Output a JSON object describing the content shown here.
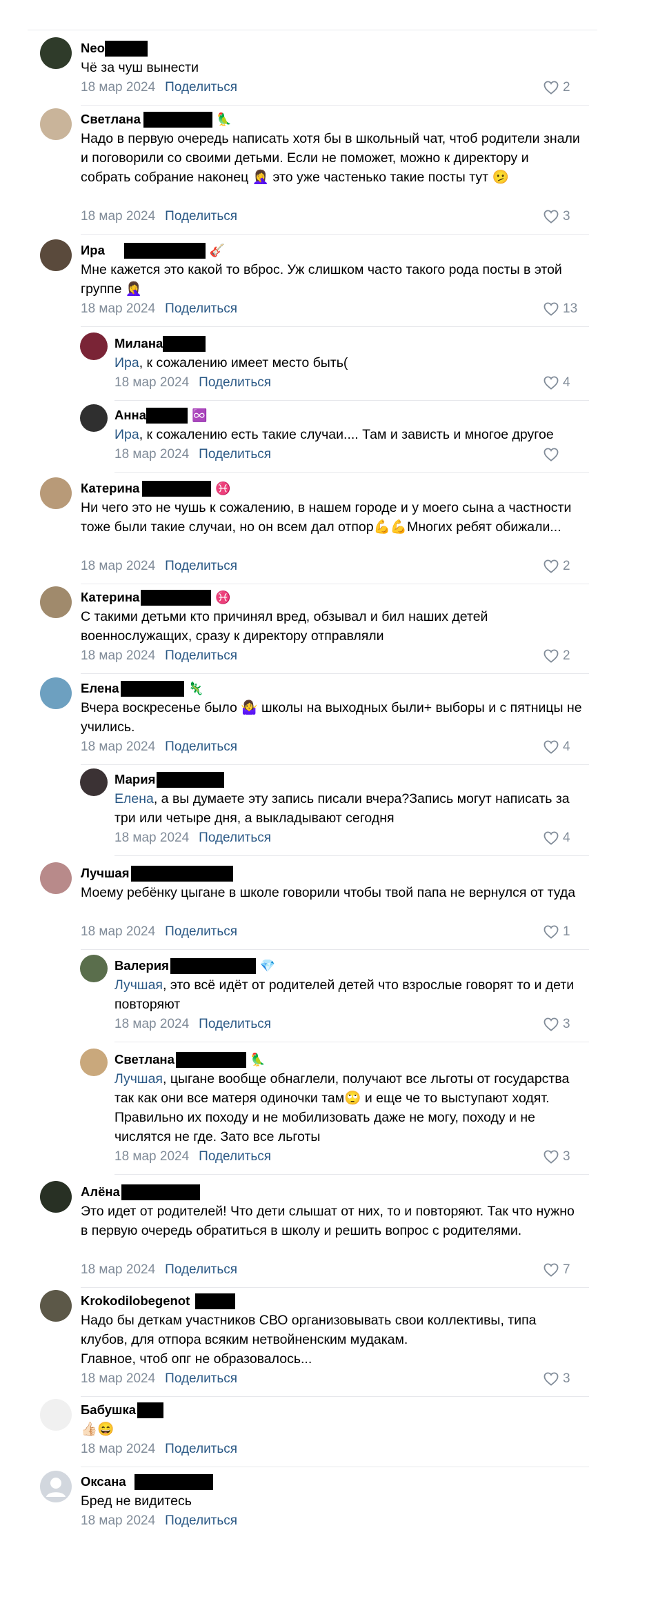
{
  "share_label": "Поделиться",
  "date": "18 мар 2024",
  "comments": [
    {
      "name": "Neo",
      "text": "Чё за чуш вынести",
      "likes": "2"
    },
    {
      "name": "Светлана",
      "badge": "🦜",
      "text": "Надо в первую очередь написать хотя бы в школьный чат, чтоб родители знали и поговорили со своими детьми. Если не поможет, можно к директору и собрать собрание наконец 🤦‍♀️ это уже частенько такие посты тут 🫤",
      "likes": "3"
    },
    {
      "name": "Ира",
      "badge": "🎸",
      "text": "Мне кажется это какой то вброс. Уж слишком часто такого рода посты в этой группе 🤦‍♀️",
      "likes": "13"
    },
    {
      "name": "Милана",
      "mention": "Ира",
      "text": ", к сожалению имеет место быть(",
      "likes": "4"
    },
    {
      "name": "Анна",
      "badge": "♾️",
      "mention": "Ира",
      "text": ", к сожалению есть такие случаи.... Там и зависть и многое другое",
      "likes": ""
    },
    {
      "name": "Катерина",
      "badge": "♓",
      "text": "Ни чего это не чушь к сожалению, в нашем городе и у моего сына а частности тоже были такие случаи, но он всем дал отпор💪💪Многих ребят обижали...",
      "likes": "2"
    },
    {
      "name": "Катерина",
      "badge": "♓",
      "text": "С такими детьми кто причинял вред, обзывал и бил наших детей военнослужащих, сразу к директору отправляли",
      "likes": "2"
    },
    {
      "name": "Елена",
      "badge": "🦎",
      "text": "Вчера воскресенье было 🤷‍♀️ школы на выходных были+ выборы и с пятницы не учились.",
      "likes": "4"
    },
    {
      "name": "Мария",
      "mention": "Елена",
      "text": ", а вы думаете эту запись писали вчера?Запись могут написать за три или четыре дня, а выкладывают сегодня",
      "likes": "4"
    },
    {
      "name": "Лучшая",
      "text": "Моему ребёнку цыгане в школе говорили чтобы твой папа не вернулся от туда",
      "likes": "1"
    },
    {
      "name": "Валерия",
      "badge": "💎",
      "mention": "Лучшая",
      "text": ", это всё идёт от родителей детей что взрослые говорят то и дети повторяют",
      "likes": "3"
    },
    {
      "name": "Светлана",
      "badge": "🦜",
      "mention": "Лучшая",
      "text": ", цыгане вообще обнаглели, получают все льготы от государства так как они все матеря одиночки там🙄 и еще че то выступают ходят. Правильно их походу и не мобилизовать даже не могу, походу и не числятся не где. Зато все льготы",
      "likes": "3"
    },
    {
      "name": "Алёна",
      "text": "Это идет от родителей! Что дети слышат от них, то и повторяют. Так что нужно в первую очередь обратиться в школу и решить вопрос с родителями.",
      "likes": "7"
    },
    {
      "name": "Krokodilobegenot",
      "text": "Надо бы деткам участников СВО организовывать свои коллективы, типа клубов, для отпора всяким нетвойненским мудакам.\nГлавное, чтоб опг не образовалось...",
      "likes": "3"
    },
    {
      "name": "Бабушка",
      "text": "👍🏻😄",
      "likes": ""
    },
    {
      "name": "Оксана",
      "text": "Бред не видитесь",
      "likes": ""
    }
  ]
}
